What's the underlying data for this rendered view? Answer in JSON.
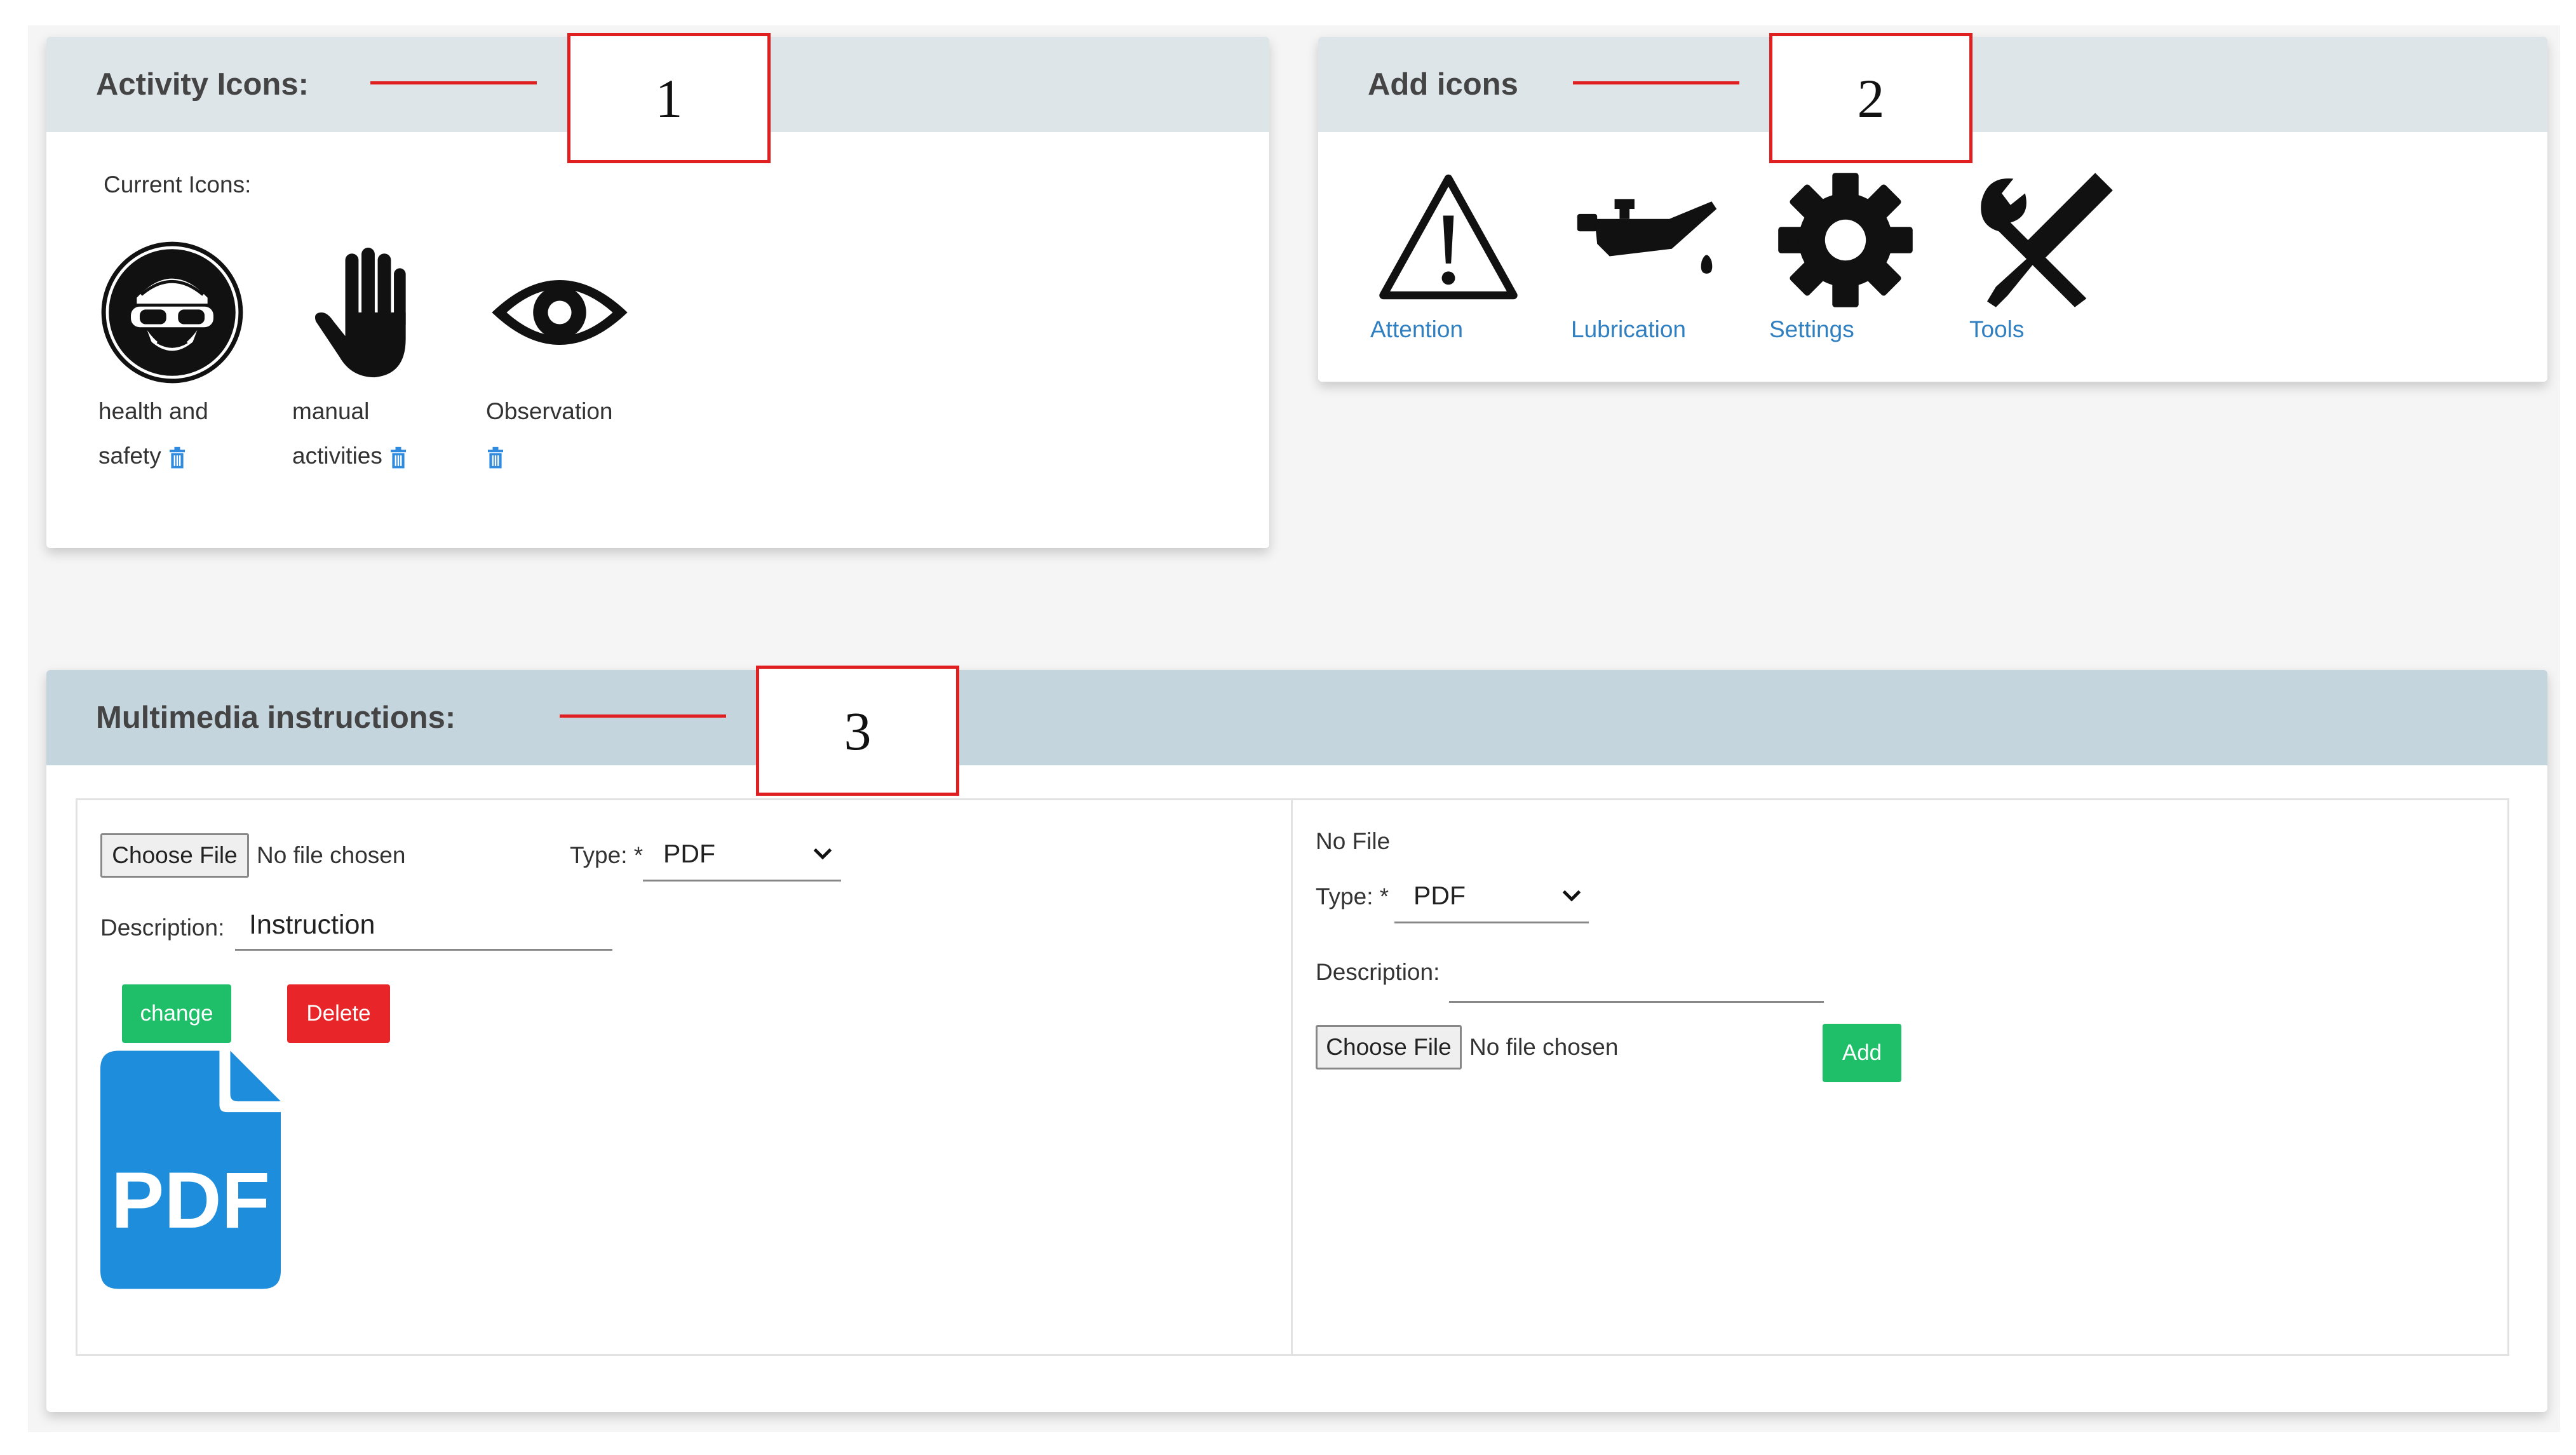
{
  "activity_icons": {
    "title": "Activity Icons:",
    "callout": "1",
    "current_label": "Current Icons:",
    "icons": [
      {
        "line1": "health and",
        "line2": "safety",
        "icon": "safety-goggles-icon"
      },
      {
        "line1": "manual",
        "line2": "activities",
        "icon": "hand-icon"
      },
      {
        "line1": "Observation",
        "line2": "",
        "icon": "eye-icon"
      }
    ]
  },
  "add_icons": {
    "title": "Add icons",
    "callout": "2",
    "icons": [
      {
        "label": "Attention",
        "icon": "warning-icon"
      },
      {
        "label": "Lubrication",
        "icon": "oil-can-icon"
      },
      {
        "label": "Settings",
        "icon": "gear-icon"
      },
      {
        "label": "Tools",
        "icon": "tools-icon"
      }
    ],
    "label_color": "#2f7fc1"
  },
  "multimedia": {
    "title": "Multimedia instructions:",
    "callout": "3",
    "left": {
      "choose_file": "Choose File",
      "no_file": "No file chosen",
      "type_label": "Type: *",
      "type_value": "PDF",
      "description_label": "Description:",
      "description_value": "Instruction",
      "change_label": "change",
      "delete_label": "Delete",
      "file_icon_text": "PDF"
    },
    "right": {
      "no_file_title": "No File",
      "type_label": "Type: *",
      "type_value": "PDF",
      "description_label": "Description:",
      "choose_file": "Choose File",
      "no_file": "No file chosen",
      "add_label": "Add"
    }
  },
  "colors": {
    "green": "#1fbf6a",
    "red": "#e8262a",
    "blue": "#1e8ddb",
    "callout": "#e02020"
  }
}
